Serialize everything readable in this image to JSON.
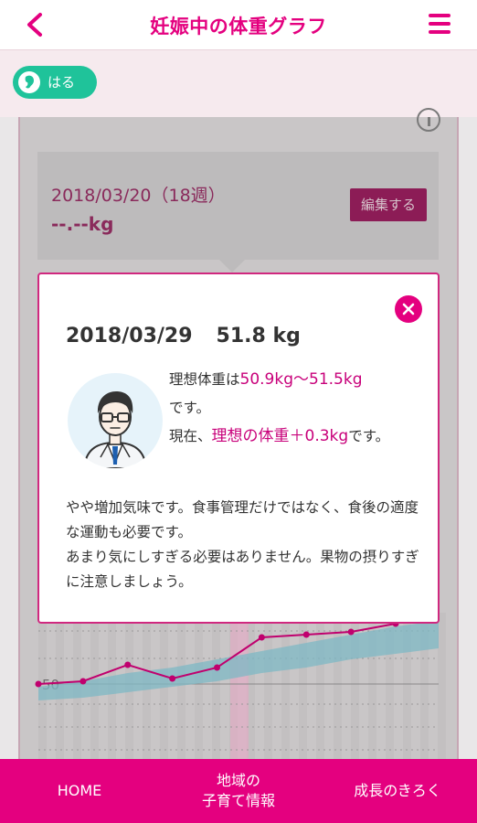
{
  "header": {
    "title": "妊娠中の体重グラフ",
    "back_icon": "chevron-left-icon",
    "menu_icon": "hamburger-menu-icon",
    "accent_color": "#e4007f"
  },
  "profile": {
    "name": "はる",
    "icon": "baby-icon",
    "chip_color": "#1fc39a"
  },
  "record": {
    "date_week": "2018/03/20（18週）",
    "weight": "--.--kg",
    "edit_label": "編集する"
  },
  "popup": {
    "date": "2018/03/29",
    "weight": "51.8 kg",
    "ideal_prefix": "理想体重は",
    "ideal_range": "50.9kg〜51.5kg",
    "ideal_suffix": "です。",
    "current_prefix": "現在、",
    "current_diff": "理想の体重＋0.3kg",
    "current_suffix": "です。",
    "advice_1": "やや増加気味です。食事管理だけではなく、食後の適度な運動も必要です。",
    "advice_2": "あまり気にしすぎる必要はありません。果物の摂りすぎに注意しましょう。",
    "avatar_icon": "doctor-avatar-icon",
    "close_icon": "close-icon"
  },
  "chart_data": {
    "type": "line",
    "y_tick_labels": [
      "50"
    ],
    "series": [
      {
        "values": [
          50.0,
          50.05,
          50.35,
          50.1,
          50.3,
          50.85,
          50.9,
          50.95,
          51.1
        ]
      }
    ],
    "ideal_band": {
      "lower": [
        49.7,
        49.75,
        49.85,
        49.95,
        50.05,
        50.2,
        50.3,
        50.45,
        50.55
      ],
      "upper": [
        49.95,
        50.05,
        50.2,
        50.3,
        50.45,
        50.6,
        50.75,
        50.9,
        51.05
      ]
    },
    "colors": {
      "series": "#c0006e",
      "band": "#7eb8c4",
      "highlight": "#e9a6c4"
    },
    "more_badge": "•••"
  },
  "bottom_nav": {
    "home": "HOME",
    "region_line1": "地域の",
    "region_line2": "子育て情報",
    "growth": "成長のきろく"
  }
}
